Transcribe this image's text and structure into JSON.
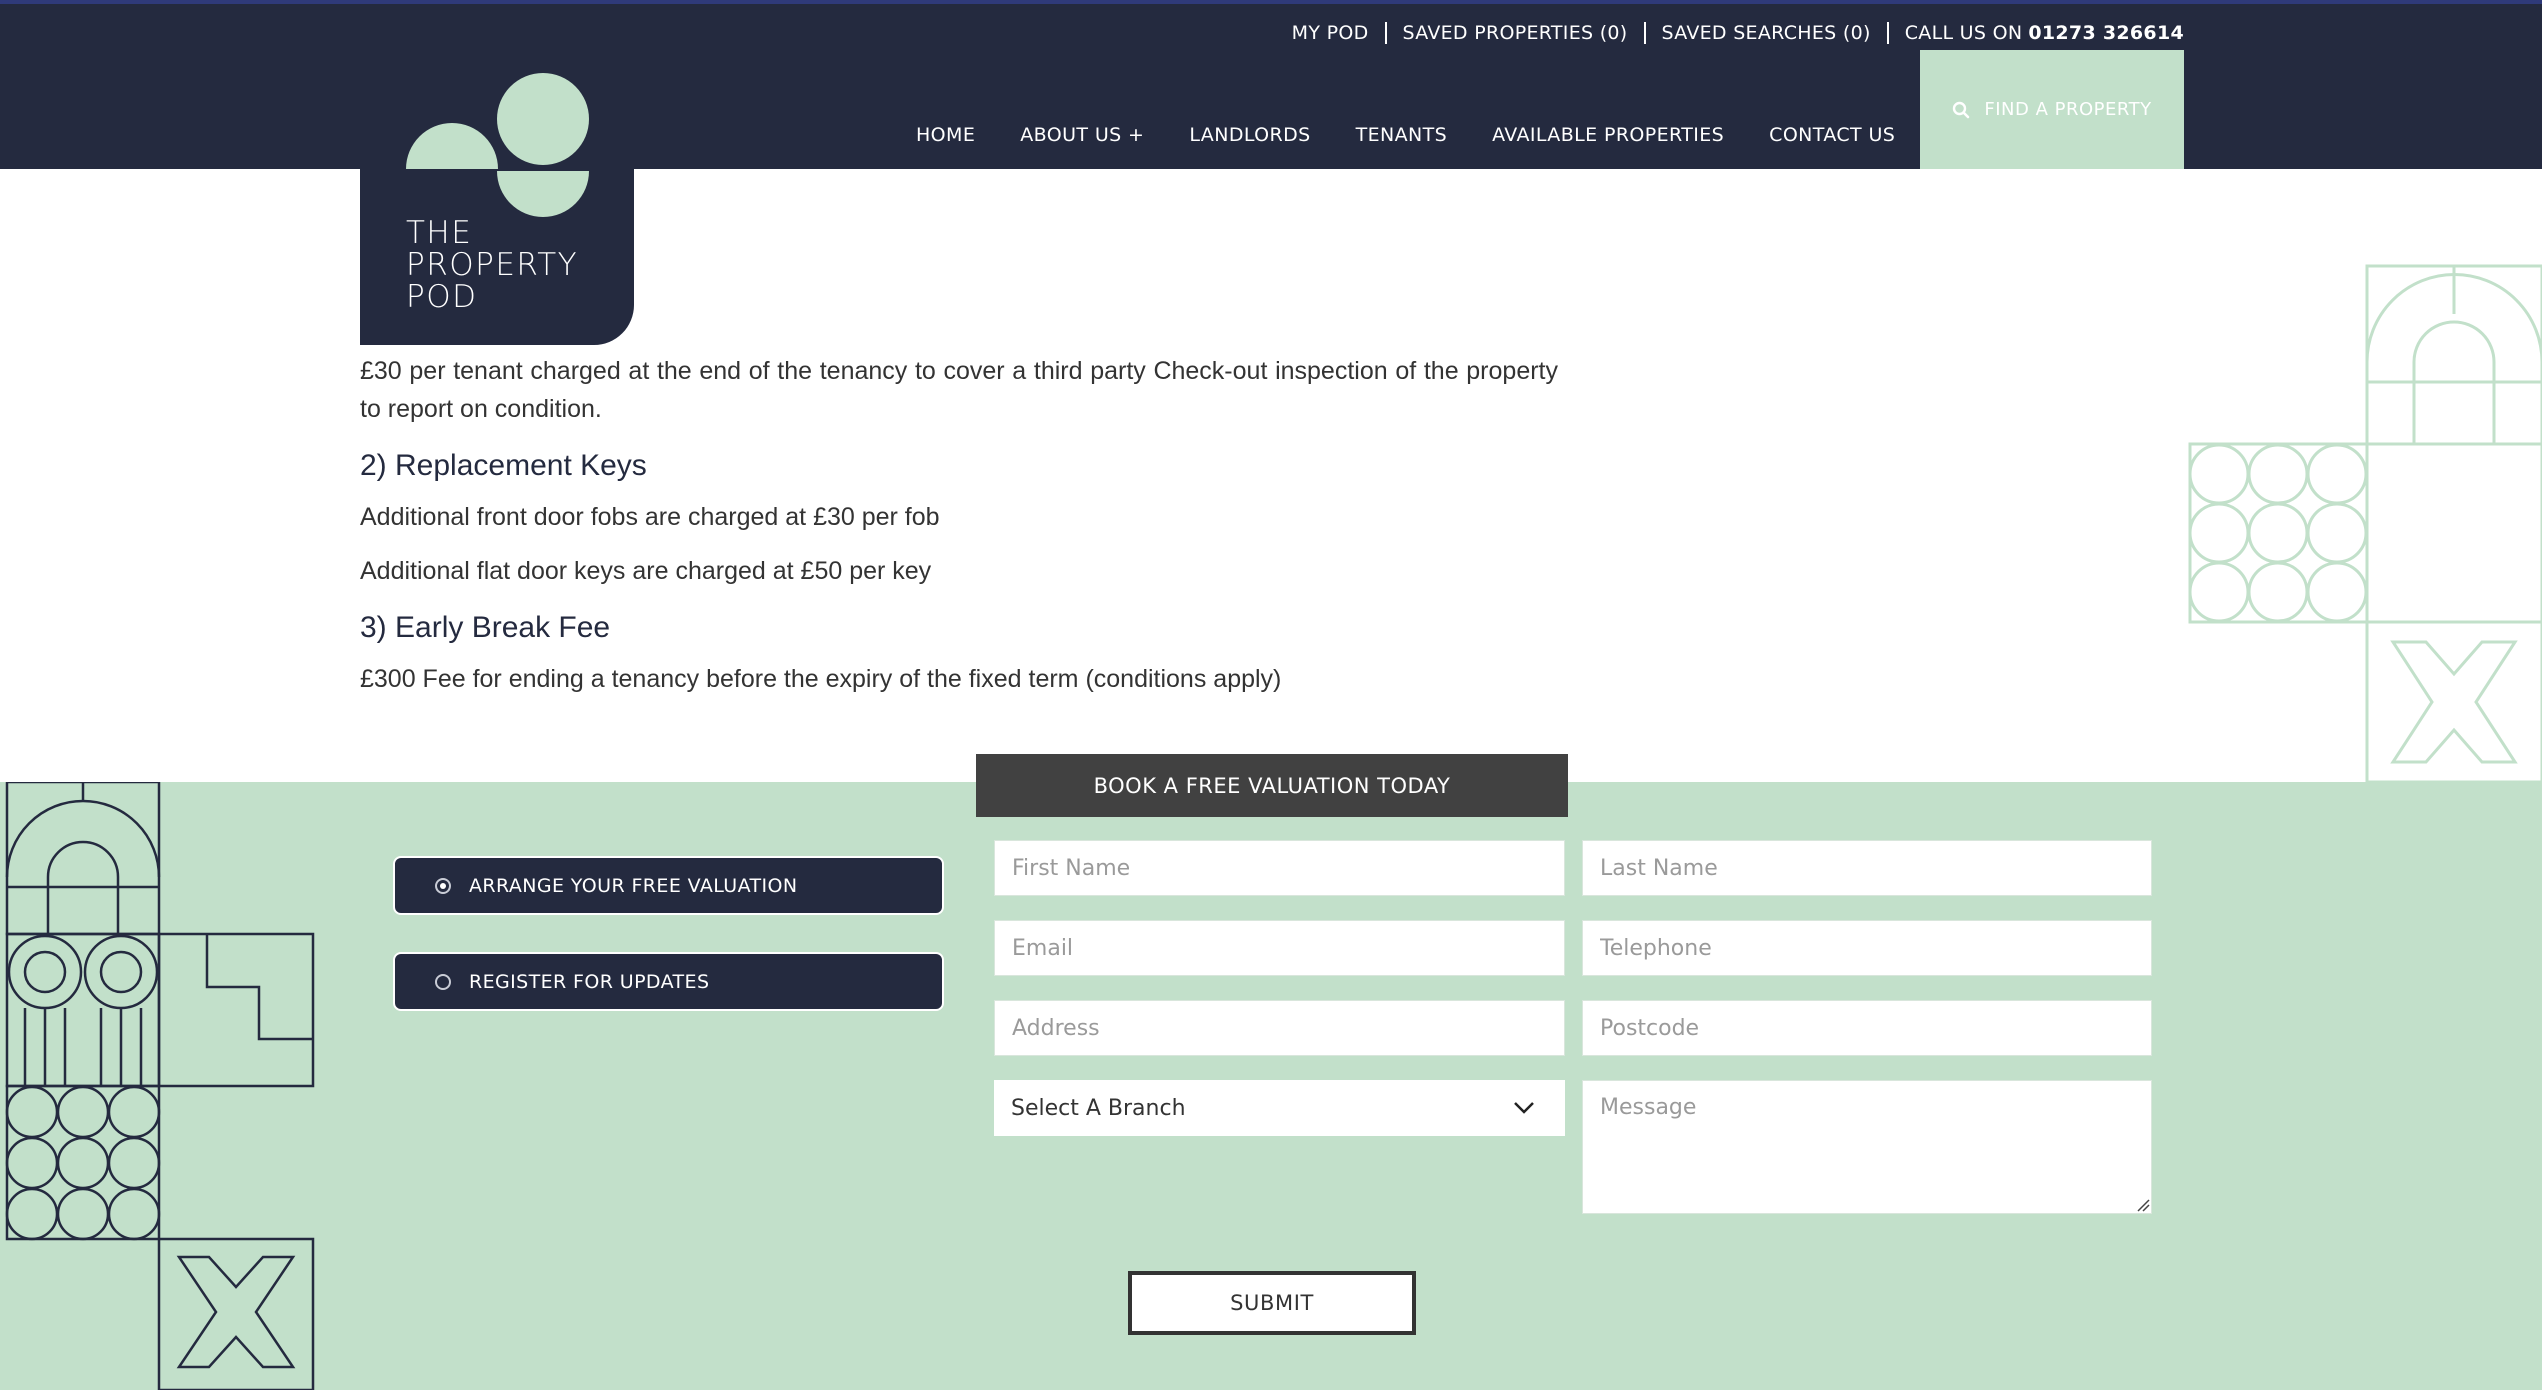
{
  "header": {
    "utility_links": [
      "MY POD",
      "SAVED PROPERTIES (0)",
      "SAVED SEARCHES (0)"
    ],
    "call_label": "CALL US ON",
    "phone": "01273 326614",
    "nav": [
      "HOME",
      "ABOUT US +",
      "LANDLORDS",
      "TENANTS",
      "AVAILABLE PROPERTIES",
      "CONTACT US"
    ],
    "find_property": "FIND A PROPERTY"
  },
  "logo": {
    "line1": "THE",
    "line2": "PROPERTY",
    "line3": "POD"
  },
  "content": {
    "intro": "£30 per tenant charged at the end of the tenancy to cover a third party Check-out inspection of the property to report on condition.",
    "section2_title": "2) Replacement Keys",
    "section2_p1": "Additional front door fobs are charged at £30 per fob",
    "section2_p2": "Additional flat door keys are charged at £50 per key",
    "section3_title": "3) Early Break Fee",
    "section3_p1": "£300 Fee for ending a tenancy before the expiry of the fixed term (conditions apply)"
  },
  "form": {
    "tab_title": "BOOK A FREE VALUATION TODAY",
    "options": [
      {
        "label": "ARRANGE YOUR FREE VALUATION",
        "selected": true
      },
      {
        "label": "REGISTER FOR UPDATES",
        "selected": false
      }
    ],
    "placeholders": {
      "first_name": "First Name",
      "last_name": "Last Name",
      "email": "Email",
      "telephone": "Telephone",
      "address": "Address",
      "postcode": "Postcode",
      "message": "Message"
    },
    "branch_select": "Select A Branch",
    "submit": "SUBMIT"
  },
  "colors": {
    "navy": "#242a3f",
    "mint": "#c2e0ca",
    "dark_grey": "#414141"
  },
  "icons": [
    "search-icon",
    "chevron-down-icon",
    "radio-selected-icon",
    "radio-empty-icon",
    "resize-grip-icon"
  ]
}
